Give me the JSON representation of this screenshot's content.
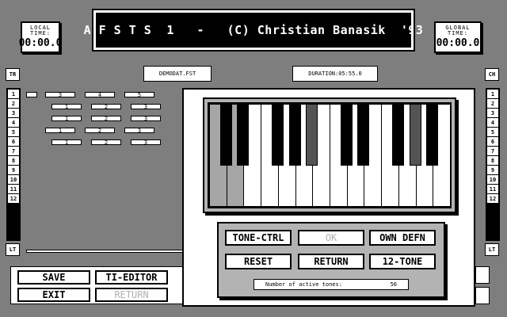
{
  "header": {
    "title": "A F S T S  1   -   (C) Christian Banasik  '93",
    "local_time": {
      "label": "LOCAL TIME:",
      "value": "00:00.0"
    },
    "global_time": {
      "label": "GLOBAL TIME:",
      "value": "00:00.0"
    }
  },
  "file": {
    "name": "DEMODAT.FST",
    "duration": "DURATION:05:55.0"
  },
  "left_track": {
    "label": "TR",
    "numbers": [
      "1",
      "2",
      "3",
      "4",
      "5",
      "6",
      "7",
      "8",
      "9",
      "10",
      "11",
      "12"
    ],
    "bottom": "LT"
  },
  "right_track": {
    "label": "CH",
    "numbers": [
      "1",
      "2",
      "3",
      "4",
      "5",
      "6",
      "7",
      "8",
      "9",
      "10",
      "11",
      "12"
    ],
    "bottom": "LT"
  },
  "sequence_rows": [
    [
      "3",
      "4",
      "5"
    ],
    [
      "1",
      "2",
      "3"
    ],
    [
      "1",
      "2",
      "3"
    ],
    [
      "1",
      "2",
      "3"
    ],
    [
      "1",
      "2",
      "3"
    ]
  ],
  "main_buttons": {
    "save": "SAVE",
    "ti_editor": "TI-EDITOR",
    "exit": "EXIT",
    "return": "RETURN"
  },
  "dialog": {
    "buttons": {
      "tone_ctrl": "TONE-CTRL",
      "ok": "OK",
      "own_defn": "OWN DEFN",
      "reset": "RESET",
      "return": "RETURN",
      "twelve_tone": "12-TONE"
    },
    "active_tones_label": "Number of active tones:",
    "active_tones_value": "56",
    "cursor_icon": "eighth-note-icon",
    "held_white_keys": [
      0,
      1
    ],
    "held_black_keys": [
      4,
      8
    ]
  },
  "colors": {
    "background": "#9a9a9a",
    "ink": "#000000",
    "paper": "#ffffff",
    "disabled": "#b0b0b0"
  }
}
